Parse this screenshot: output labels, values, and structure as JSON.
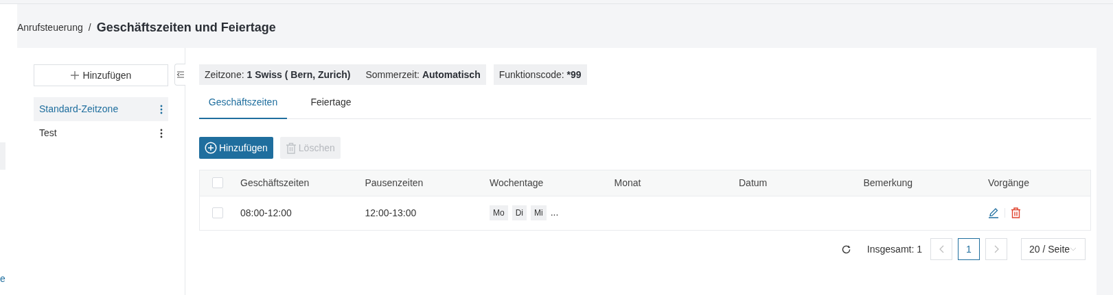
{
  "sidebar_link": "e",
  "breadcrumb": {
    "parent": "Anrufsteuerung",
    "separator": "/",
    "title": "Geschäftszeiten und Feiertage"
  },
  "zone_panel": {
    "add_button": "Hinzufügen",
    "items": [
      {
        "label": "Standard-Zeitzone",
        "selected": true
      },
      {
        "label": "Test",
        "selected": false
      }
    ]
  },
  "info_tags": [
    {
      "parts": [
        {
          "label": "Zeitzone:",
          "value": "1 Swiss ( Bern, Zurich)"
        },
        {
          "label": "Sommerzeit:",
          "value": "Automatisch"
        }
      ]
    },
    {
      "parts": [
        {
          "label": "Funktionscode:",
          "value": "*99"
        }
      ]
    }
  ],
  "tabs": [
    {
      "label": "Geschäftszeiten",
      "selected": true
    },
    {
      "label": "Feiertage",
      "selected": false
    }
  ],
  "toolbar": [
    {
      "label": "Hinzufügen",
      "kind": "add",
      "disabled": false
    },
    {
      "label": "Löschen",
      "kind": "delete",
      "disabled": true
    }
  ],
  "table": {
    "select_all_checked": false,
    "columns": [
      "Geschäftszeiten",
      "Pausenzeiten",
      "Wochentage",
      "Monat",
      "Datum",
      "Bemerkung",
      "Vorgänge"
    ],
    "rows": [
      {
        "checked": false,
        "business_hours": "08:00-12:00",
        "break_times": "12:00-13:00",
        "weekdays": [
          "Mo",
          "Di",
          "Mi"
        ],
        "weekdays_more": "..."
      }
    ]
  },
  "pagination": {
    "total": "Insgesamt: 1",
    "pages": [
      {
        "label": "1",
        "selected": true
      }
    ],
    "page_size": "20 / Seite"
  }
}
